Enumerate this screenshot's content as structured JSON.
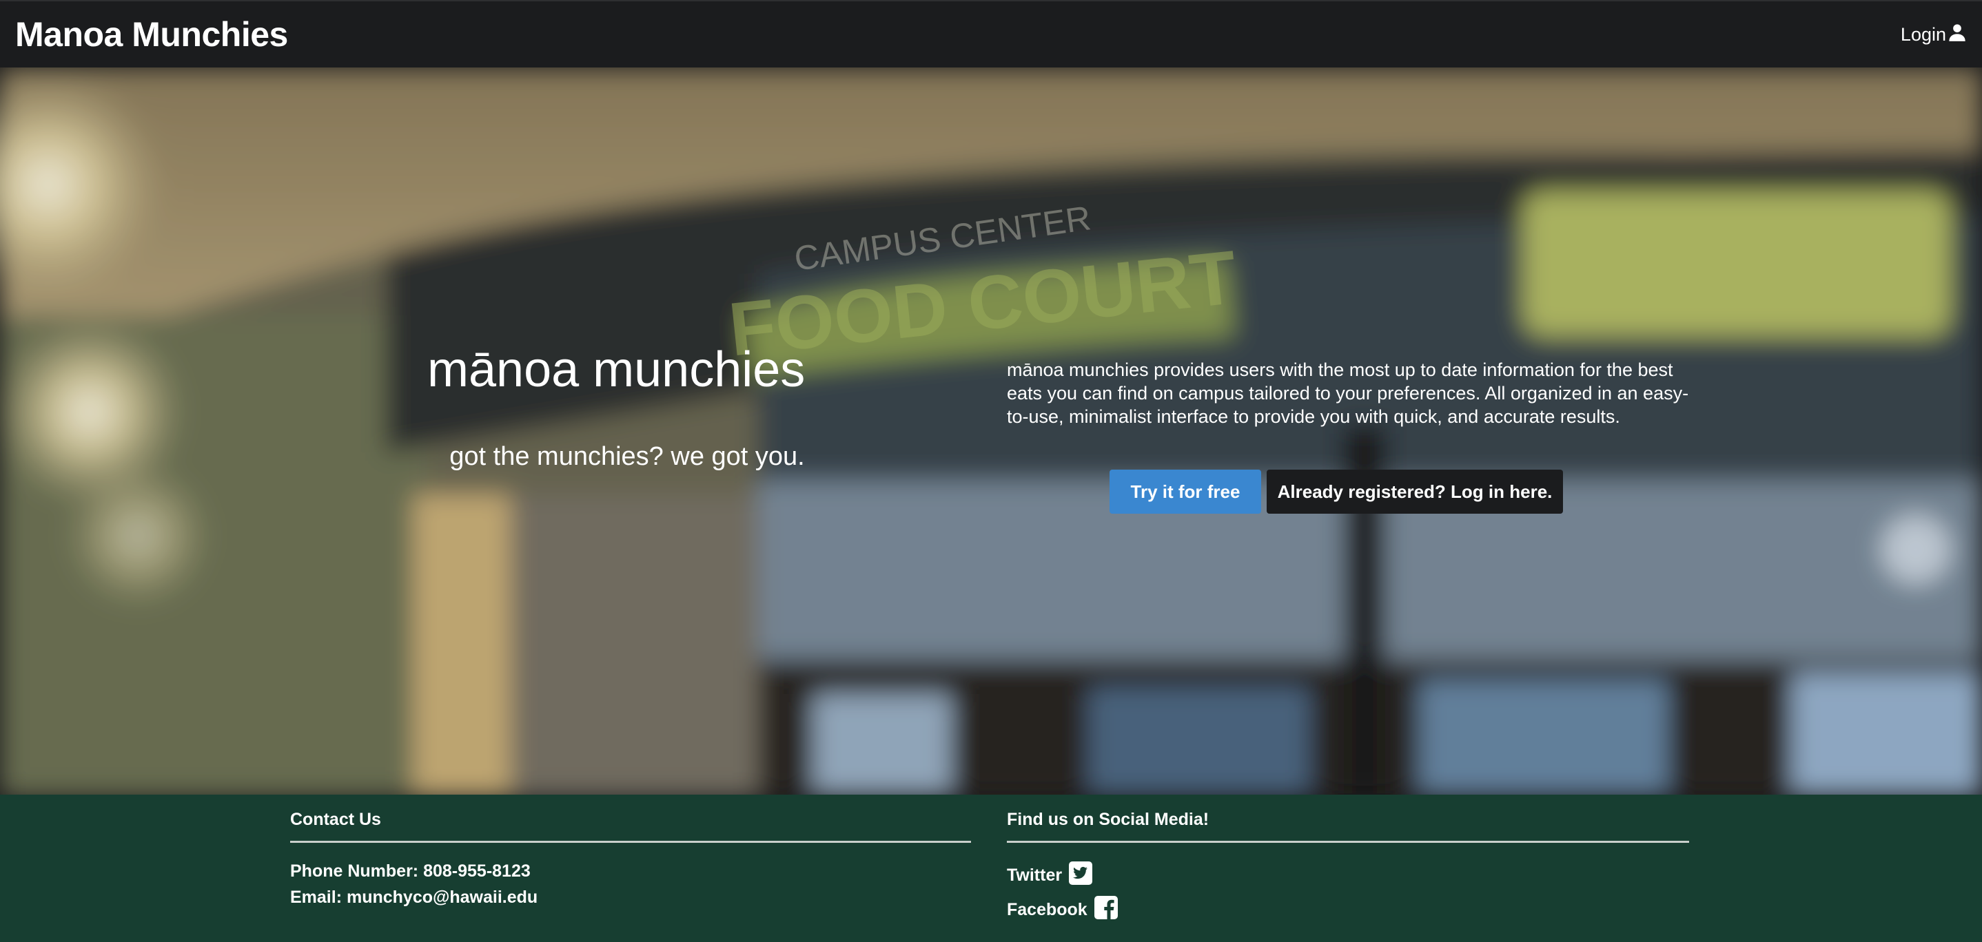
{
  "navbar": {
    "brand": "Manoa Munchies",
    "login_label": "Login",
    "login_icon": "user-icon"
  },
  "hero": {
    "title": "mānoa munchies",
    "tagline": "got the munchies? we got you.",
    "description": "mānoa munchies provides users with the most up to date information for the best eats you can find on campus tailored to your preferences. All organized in an easy-to-use, minimalist interface to provide you with quick, and accurate results.",
    "primary_button": "Try it for free",
    "secondary_button": "Already registered? Log in here.",
    "background_signage": {
      "campus_center": "CAMPUS CENTER",
      "food_court": "FOOD COURT"
    }
  },
  "footer": {
    "contact": {
      "heading": "Contact Us",
      "phone": "Phone Number: 808-955-8123",
      "email": "Email: munchyco@hawaii.edu"
    },
    "social": {
      "heading": "Find us on Social Media!",
      "twitter": "Twitter",
      "facebook": "Facebook"
    }
  },
  "colors": {
    "navbar": "#1b1c1e",
    "primary_button": "#3a87d0",
    "footer": "#173e31"
  }
}
